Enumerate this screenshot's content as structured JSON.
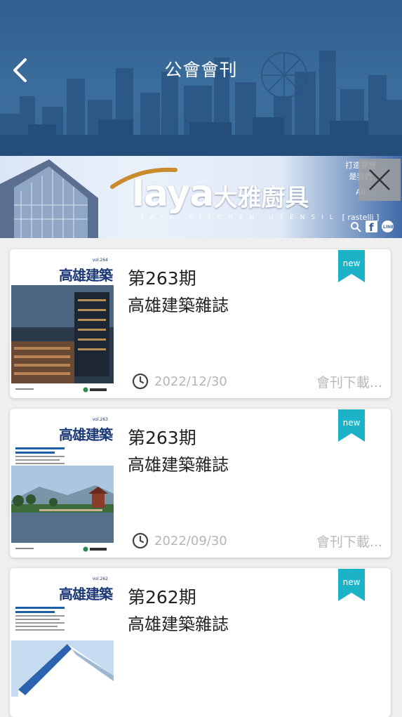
{
  "header": {
    "title": "公會會刊",
    "back_icon": "chevron-left-icon"
  },
  "banner": {
    "brand_en": "laya",
    "brand_cn": "大雅廚具",
    "sub": "TAYA KITCHEN UTENSIL",
    "right_line1": "打造夢想",
    "right_line2": "是我們",
    "right_line3": "All",
    "right_line4": "[ rastelli ]",
    "close_icon": "close-icon"
  },
  "cards": [
    {
      "issue": "第263期",
      "name": "高雄建築雜誌",
      "date": "2022/12/30",
      "download": "會刊下載...",
      "badge": "new",
      "cover_vol": "vol.264"
    },
    {
      "issue": "第263期",
      "name": "高雄建築雜誌",
      "date": "2022/09/30",
      "download": "會刊下載...",
      "badge": "new",
      "cover_vol": "vol.263"
    },
    {
      "issue": "第262期",
      "name": "高雄建築雜誌",
      "date": "",
      "download": "",
      "badge": "new",
      "cover_vol": "vol.262"
    }
  ],
  "cover_title": "高雄建築",
  "colors": {
    "header_bg": "#2f5f8e",
    "badge": "#1cb3c8",
    "accent_text": "#222222"
  }
}
